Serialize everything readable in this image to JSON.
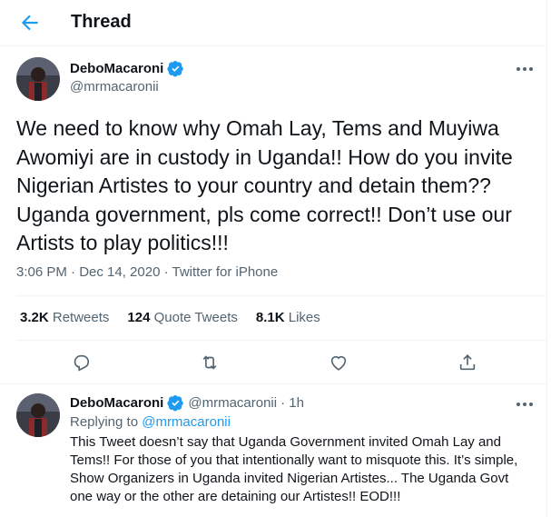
{
  "header": {
    "title": "Thread"
  },
  "colors": {
    "accent": "#1d9bf0",
    "text": "#0f1419",
    "muted": "#536471",
    "divider": "#eff3f4"
  },
  "icons": {
    "back": "arrow-left-icon",
    "verified": "verified-badge-icon",
    "more": "more-dots-icon",
    "reply": "reply-icon",
    "retweet": "retweet-icon",
    "like": "heart-icon",
    "share": "share-icon"
  },
  "tweet": {
    "display_name": "DeboMacaroni",
    "handle": "@mrmacaronii",
    "text": "We need to know why Omah Lay, Tems and Muyiwa Awomiyi are in custody in Uganda!! How do you invite Nigerian Artistes to your country and detain them?? Uganda government, pls come correct!! Don’t use our Artists to play politics!!!",
    "meta": "3:06 PM · Dec 14, 2020 · Twitter for iPhone",
    "stats": {
      "retweets_count": "3.2K",
      "retweets_label": "Retweets",
      "quotes_count": "124",
      "quotes_label": "Quote Tweets",
      "likes_count": "8.1K",
      "likes_label": "Likes"
    }
  },
  "reply": {
    "display_name": "DeboMacaroni",
    "handle": "@mrmacaronii",
    "time": "· 1h",
    "replying_prefix": "Replying to",
    "replying_to": "@mrmacaronii",
    "text": "This Tweet doesn’t say that Uganda Government invited Omah Lay and Tems!! For those of you that intentionally want to misquote this. It’s simple, Show Organizers in Uganda invited Nigerian Artistes... The Uganda Govt one way or the other are detaining our Artistes!! EOD!!!"
  }
}
